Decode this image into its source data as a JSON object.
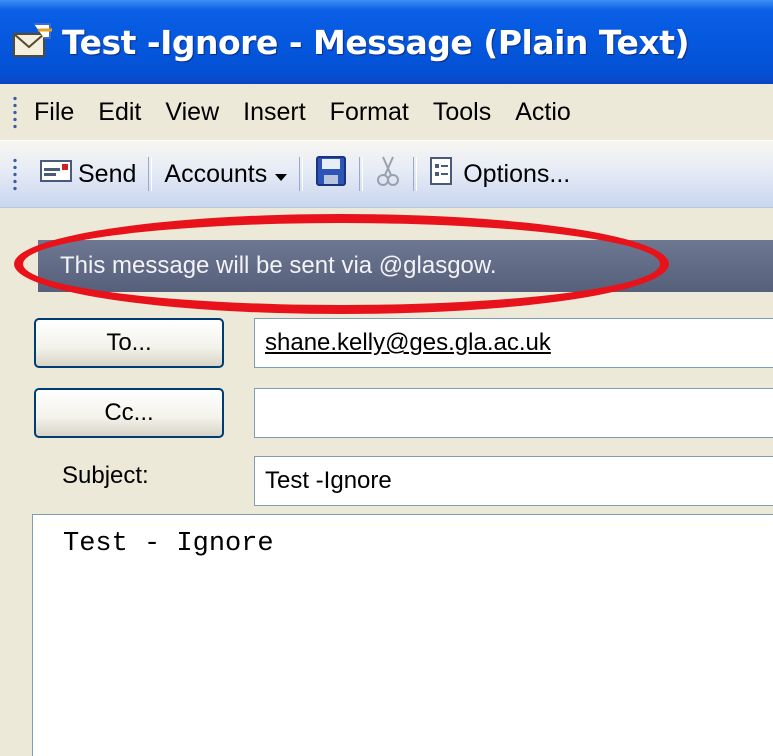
{
  "window": {
    "title": "Test -Ignore - Message (Plain Text)"
  },
  "menu": {
    "items": [
      "File",
      "Edit",
      "View",
      "Insert",
      "Format",
      "Tools",
      "Actio"
    ]
  },
  "toolbar": {
    "send_label": "Send",
    "accounts_label": "Accounts",
    "options_label": "Options..."
  },
  "infobar": {
    "text": "This message will be sent via @glasgow."
  },
  "address": {
    "to_button": "To...",
    "to_value": "shane.kelly@ges.gla.ac.uk",
    "cc_button": "Cc...",
    "cc_value": "",
    "subject_label": "Subject:",
    "subject_value": "Test -Ignore"
  },
  "body": {
    "text": "Test - Ignore"
  },
  "icons": {
    "title": "envelope-icon",
    "send": "send-mail-icon",
    "accounts_dropdown": "chevron-down-icon",
    "save": "floppy-disk-icon",
    "cut": "scissors-icon",
    "options": "options-icon"
  },
  "colors": {
    "titlebar": "#0558de",
    "infobar": "#626b85",
    "highlight_oval": "#e8121a"
  }
}
